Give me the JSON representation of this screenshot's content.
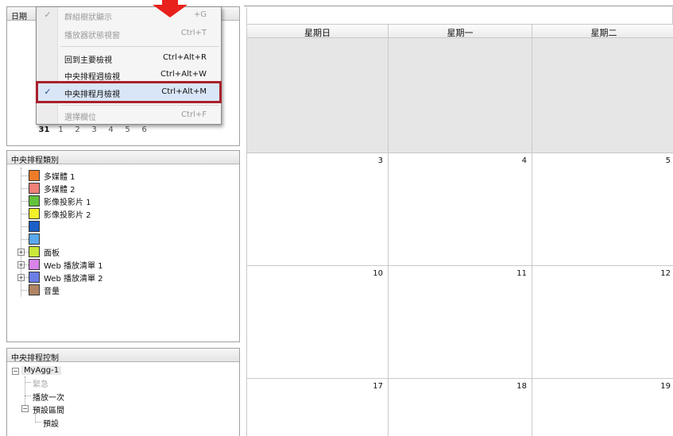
{
  "date_panel": {
    "title": "日期",
    "visible_days": [
      {
        "label": "31",
        "current": true
      },
      {
        "label": "1",
        "current": false
      },
      {
        "label": "2",
        "current": false
      },
      {
        "label": "3",
        "current": false
      },
      {
        "label": "4",
        "current": false
      },
      {
        "label": "5",
        "current": false
      },
      {
        "label": "6",
        "current": false
      }
    ]
  },
  "context_menu": {
    "items": [
      {
        "label": "群組樹狀顯示",
        "shortcut": "+G",
        "checked": true,
        "disabled": true
      },
      {
        "label": "播放器狀態視窗",
        "shortcut": "Ctrl+T",
        "checked": false,
        "disabled": true
      },
      {
        "label": "回到主要檢視",
        "shortcut": "Ctrl+Alt+R",
        "checked": false,
        "disabled": false
      },
      {
        "label": "中央排程週檢視",
        "shortcut": "Ctrl+Alt+W",
        "checked": false,
        "disabled": false
      },
      {
        "label": "中央排程月檢視",
        "shortcut": "Ctrl+Alt+M",
        "checked": true,
        "disabled": false,
        "highlighted": true
      },
      {
        "label": "選擇欄位",
        "shortcut": "Ctrl+F",
        "checked": false,
        "disabled": true
      }
    ],
    "check_glyph": "✓"
  },
  "category_panel": {
    "title": "中央排程類別",
    "items": [
      {
        "label": "多媒體 1",
        "color": "#f07c2a",
        "expandable": false
      },
      {
        "label": "多媒體 2",
        "color": "#f08078",
        "expandable": false
      },
      {
        "label": "影像投影片 1",
        "color": "#62c23a",
        "expandable": false
      },
      {
        "label": "影像投影片 2",
        "color": "#f4f02a",
        "expandable": false
      },
      {
        "label": "",
        "color": "#1a5fc8",
        "expandable": false
      },
      {
        "label": "",
        "color": "#5aa8ee",
        "expandable": false
      },
      {
        "label": "面板",
        "color": "#c8e83a",
        "expandable": true
      },
      {
        "label": "Web 播放清單 1",
        "color": "#d884e8",
        "expandable": true
      },
      {
        "label": "Web 播放清單 2",
        "color": "#6a7ee6",
        "expandable": true
      },
      {
        "label": "音量",
        "color": "#b08464",
        "expandable": false
      }
    ]
  },
  "control_panel": {
    "title": "中央排程控制",
    "root": "MyAgg-1",
    "children": [
      {
        "label": "緊急",
        "disabled": true
      },
      {
        "label": "播放一次",
        "disabled": false
      },
      {
        "label": "預設區間",
        "disabled": false
      }
    ],
    "grandchildren": [
      {
        "label": "預設",
        "disabled": false
      }
    ]
  },
  "calendar": {
    "day_headers": [
      "星期日",
      "星期一",
      "星期二"
    ],
    "weeks": [
      {
        "days": [
          "",
          "",
          ""
        ],
        "grey": true
      },
      {
        "days": [
          "3",
          "4",
          "5"
        ],
        "grey": false
      },
      {
        "days": [
          "10",
          "11",
          "12"
        ],
        "grey": false
      },
      {
        "days": [
          "17",
          "18",
          "19"
        ],
        "grey": false
      }
    ]
  },
  "colors": {
    "highlight_border": "#a8202b",
    "highlight_fill": "#d9e6f7",
    "arrow": "#e8211c",
    "grey_cell": "#e6e6e6"
  }
}
